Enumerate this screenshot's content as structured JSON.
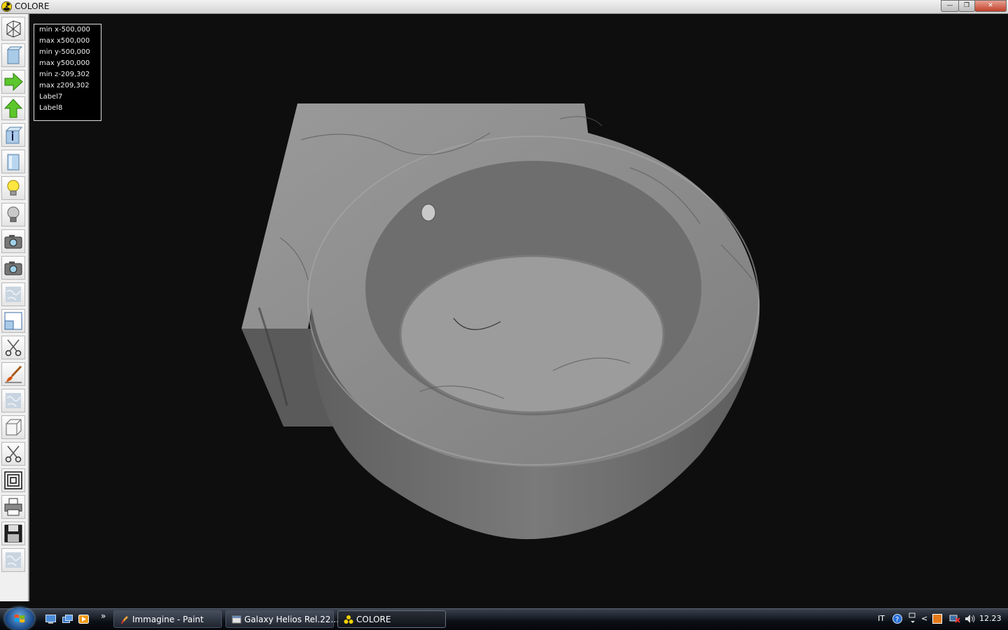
{
  "window": {
    "title": "COLORE",
    "minimize_glyph": "—",
    "restore_glyph": "❐",
    "close_glyph": "✕"
  },
  "toolbar": {
    "tools": [
      {
        "name": "wireframe-tool",
        "icon": "wireframe-box-icon"
      },
      {
        "name": "solid-view-tool",
        "icon": "solid-box-icon"
      },
      {
        "name": "move-right-tool",
        "icon": "arrow-right-icon"
      },
      {
        "name": "move-up-tool",
        "icon": "arrow-up-icon"
      },
      {
        "name": "info-tool",
        "icon": "box-info-icon"
      },
      {
        "name": "box-view-tool",
        "icon": "box-icon"
      },
      {
        "name": "light-on-tool",
        "icon": "lightbulb-on-icon"
      },
      {
        "name": "light-off-tool",
        "icon": "lightbulb-off-icon"
      },
      {
        "name": "camera-tool",
        "icon": "camera-icon"
      },
      {
        "name": "camera-2-tool",
        "icon": "camera-icon"
      },
      {
        "name": "texture-tool",
        "icon": "marble-texture-icon"
      },
      {
        "name": "window-tool",
        "icon": "window-icon"
      },
      {
        "name": "cut-tool",
        "icon": "scissors-icon"
      },
      {
        "name": "paint-tool",
        "icon": "paintbrush-icon"
      },
      {
        "name": "texture-2-tool",
        "icon": "marble-texture-icon"
      },
      {
        "name": "cube-tool",
        "icon": "cube-icon"
      },
      {
        "name": "cut-2-tool",
        "icon": "scissors-icon"
      },
      {
        "name": "frame-tool",
        "icon": "concentric-squares-icon"
      },
      {
        "name": "print-tool",
        "icon": "printer-icon"
      },
      {
        "name": "save-tool",
        "icon": "floppy-disk-icon"
      },
      {
        "name": "texture-3-tool",
        "icon": "marble-texture-icon"
      }
    ]
  },
  "info": {
    "lines": [
      "min x-500,000",
      "max x500,000",
      "min y-500,000",
      "max y500,000",
      "min z-209,302",
      "max z209,302",
      "Label7",
      "Label8"
    ]
  },
  "scene": {
    "description_icon": "marble-sink-3d-model",
    "marble_color": "#8e8e8e",
    "background_color": "#0e0e0e"
  },
  "taskbar": {
    "quick_launch": [
      "show-desktop-icon",
      "switch-windows-icon",
      "media-player-icon"
    ],
    "overflow": "»",
    "tasks": [
      {
        "label": "Immagine - Paint",
        "icon": "paint-icon",
        "active": false
      },
      {
        "label": "Galaxy Helios  Rel.22...",
        "icon": "app-icon",
        "active": false
      },
      {
        "label": "COLORE",
        "icon": "radiation-icon",
        "active": true
      }
    ],
    "tray": {
      "language": "IT",
      "clock": "12.23",
      "chevron": "<"
    }
  }
}
